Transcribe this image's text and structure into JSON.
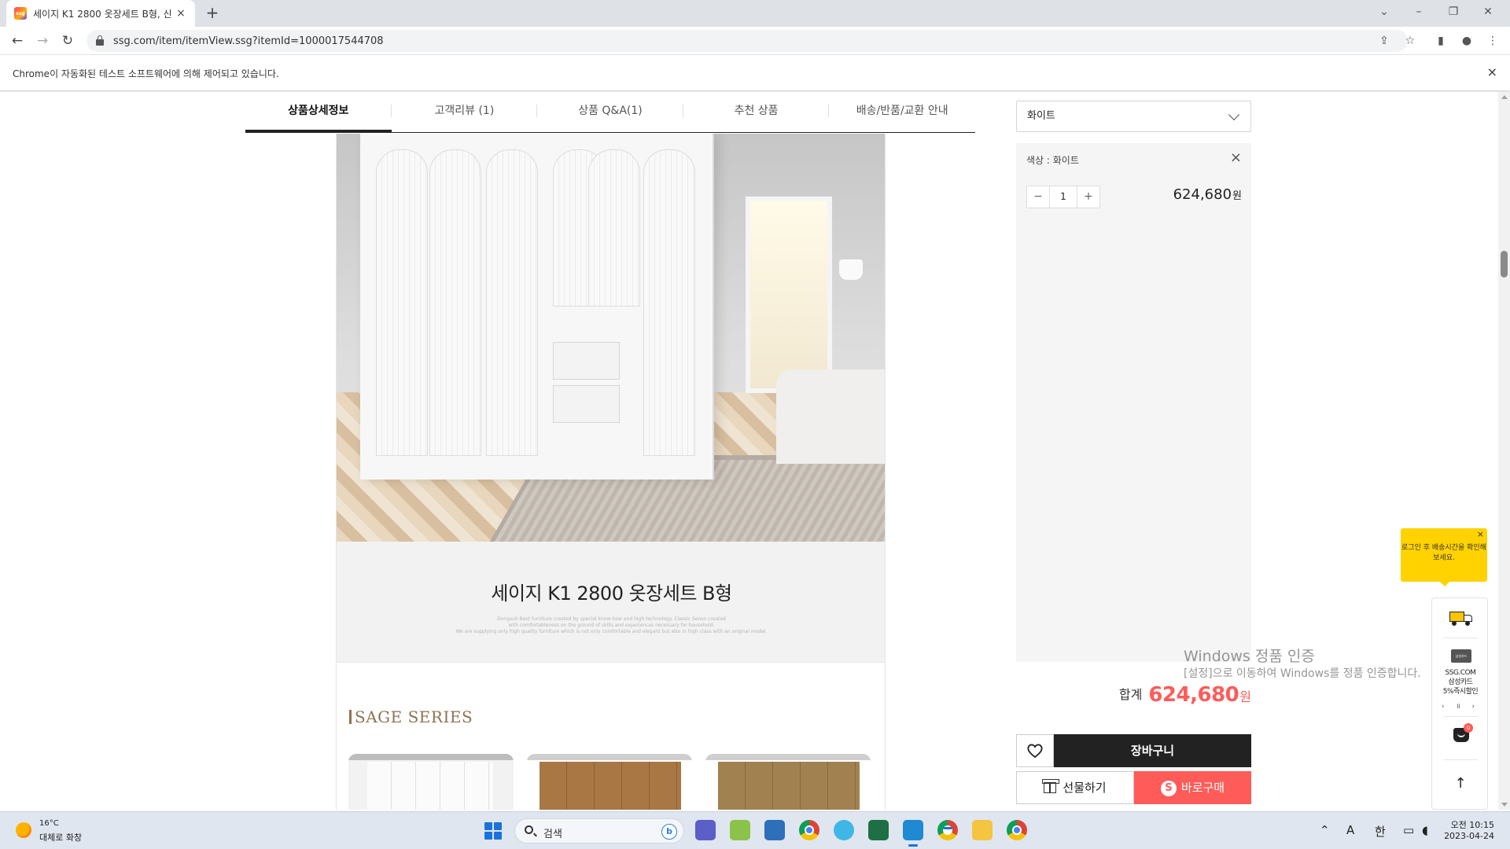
{
  "browser": {
    "tab_title": "세이지 K1 2800 옷장세트 B형, 신",
    "favicon_text": "ssg",
    "new_tab": "+",
    "url": "ssg.com/item/itemView.ssg?itemId=1000017544708",
    "infobar_text": "Chrome이 자동화된 테스트 소프트웨어에 의해 제어되고 있습니다.",
    "infobar_close": "×"
  },
  "detail_tabs": [
    {
      "label": "상품상세정보"
    },
    {
      "label": "고객리뷰 (1)"
    },
    {
      "label": "상품 Q&A(1)"
    },
    {
      "label": "추천 상품"
    },
    {
      "label": "배송/반품/교환 안내"
    }
  ],
  "product": {
    "title": "세이지 K1 2800 옷장세트 B형",
    "sub_line1": "Dongsuh Best furniture created by special know-how and high technology. Classic Senso created",
    "sub_line2": "with comfortableness on the ground of skills and experiences necessary for household.",
    "sub_line3": "We are supplying only high quality furniture which is not only comfortable and elegant but also in high class with an original model.",
    "series_title": "SAGE SERIES"
  },
  "options": {
    "select_value": "화이트",
    "option_label": "색상 : 화이트",
    "quantity": "1",
    "minus": "−",
    "plus": "+",
    "price": "624,680",
    "price_unit": "원",
    "total_label": "합계",
    "total_price": "624,680",
    "total_unit": "원"
  },
  "actions": {
    "cart": "장바구니",
    "gift": "선물하기",
    "buy": "바로구매",
    "buy_badge": "S"
  },
  "windows_watermark": {
    "title": "Windows 정품 인증",
    "sub": "[설정]으로 이동하여 Windows를 정품 인증합니다."
  },
  "floating": {
    "tooltip": "로그인 후 배송시간을 확인해보세요.",
    "tooltip_close": "×",
    "card_thumb": "삼성카드",
    "card_line1": "SSG.COM",
    "card_line2": "삼성카드",
    "card_line3": "5%즉시할인",
    "card_ctrl": "‹ ॥ ›",
    "cart_count": "0",
    "top_arrow": "↑"
  },
  "taskbar": {
    "temp": "16°C",
    "weather": "대체로 화창",
    "search_placeholder": "검색",
    "bing": "b",
    "time": "오전 10:15",
    "date": "2023-04-24",
    "tray_lang": "A",
    "tray_ime": "한"
  },
  "colors": {
    "accent_red": "#ff5b59",
    "tooltip_yellow": "#ffd200",
    "series_gold": "#8c7452"
  }
}
